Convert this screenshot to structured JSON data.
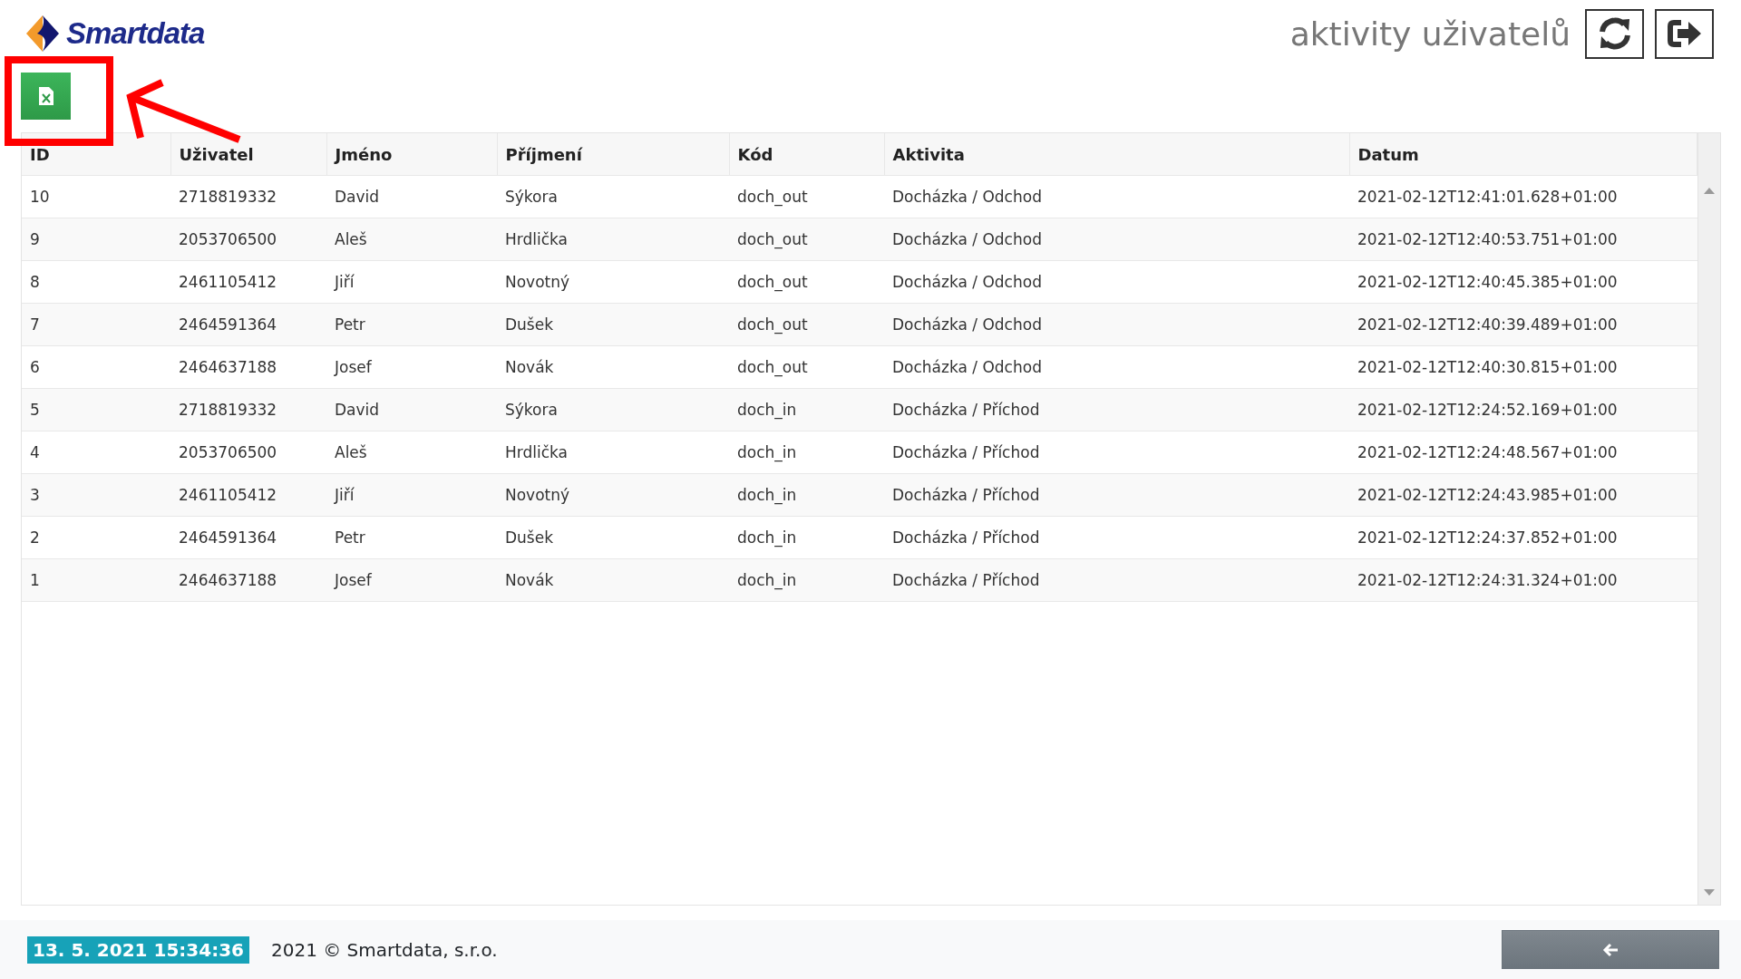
{
  "header": {
    "logo": "Smartdata",
    "title": "aktivity uživatelů"
  },
  "table": {
    "columns": [
      "ID",
      "Uživatel",
      "Jméno",
      "Příjmení",
      "Kód",
      "Aktivita",
      "Datum"
    ],
    "rows": [
      [
        "10",
        "2718819332",
        "David",
        "Sýkora",
        "doch_out",
        "Docházka / Odchod",
        "2021-02-12T12:41:01.628+01:00"
      ],
      [
        "9",
        "2053706500",
        "Aleš",
        "Hrdlička",
        "doch_out",
        "Docházka / Odchod",
        "2021-02-12T12:40:53.751+01:00"
      ],
      [
        "8",
        "2461105412",
        "Jiří",
        "Novotný",
        "doch_out",
        "Docházka / Odchod",
        "2021-02-12T12:40:45.385+01:00"
      ],
      [
        "7",
        "2464591364",
        "Petr",
        "Dušek",
        "doch_out",
        "Docházka / Odchod",
        "2021-02-12T12:40:39.489+01:00"
      ],
      [
        "6",
        "2464637188",
        "Josef",
        "Novák",
        "doch_out",
        "Docházka / Odchod",
        "2021-02-12T12:40:30.815+01:00"
      ],
      [
        "5",
        "2718819332",
        "David",
        "Sýkora",
        "doch_in",
        "Docházka / Příchod",
        "2021-02-12T12:24:52.169+01:00"
      ],
      [
        "4",
        "2053706500",
        "Aleš",
        "Hrdlička",
        "doch_in",
        "Docházka / Příchod",
        "2021-02-12T12:24:48.567+01:00"
      ],
      [
        "3",
        "2461105412",
        "Jiří",
        "Novotný",
        "doch_in",
        "Docházka / Příchod",
        "2021-02-12T12:24:43.985+01:00"
      ],
      [
        "2",
        "2464591364",
        "Petr",
        "Dušek",
        "doch_in",
        "Docházka / Příchod",
        "2021-02-12T12:24:37.852+01:00"
      ],
      [
        "1",
        "2464637188",
        "Josef",
        "Novák",
        "doch_in",
        "Docházka / Příchod",
        "2021-02-12T12:24:31.324+01:00"
      ]
    ]
  },
  "footer": {
    "datetime": "13. 5. 2021 15:34:36",
    "copyright": "2021 © Smartdata, s.r.o."
  }
}
